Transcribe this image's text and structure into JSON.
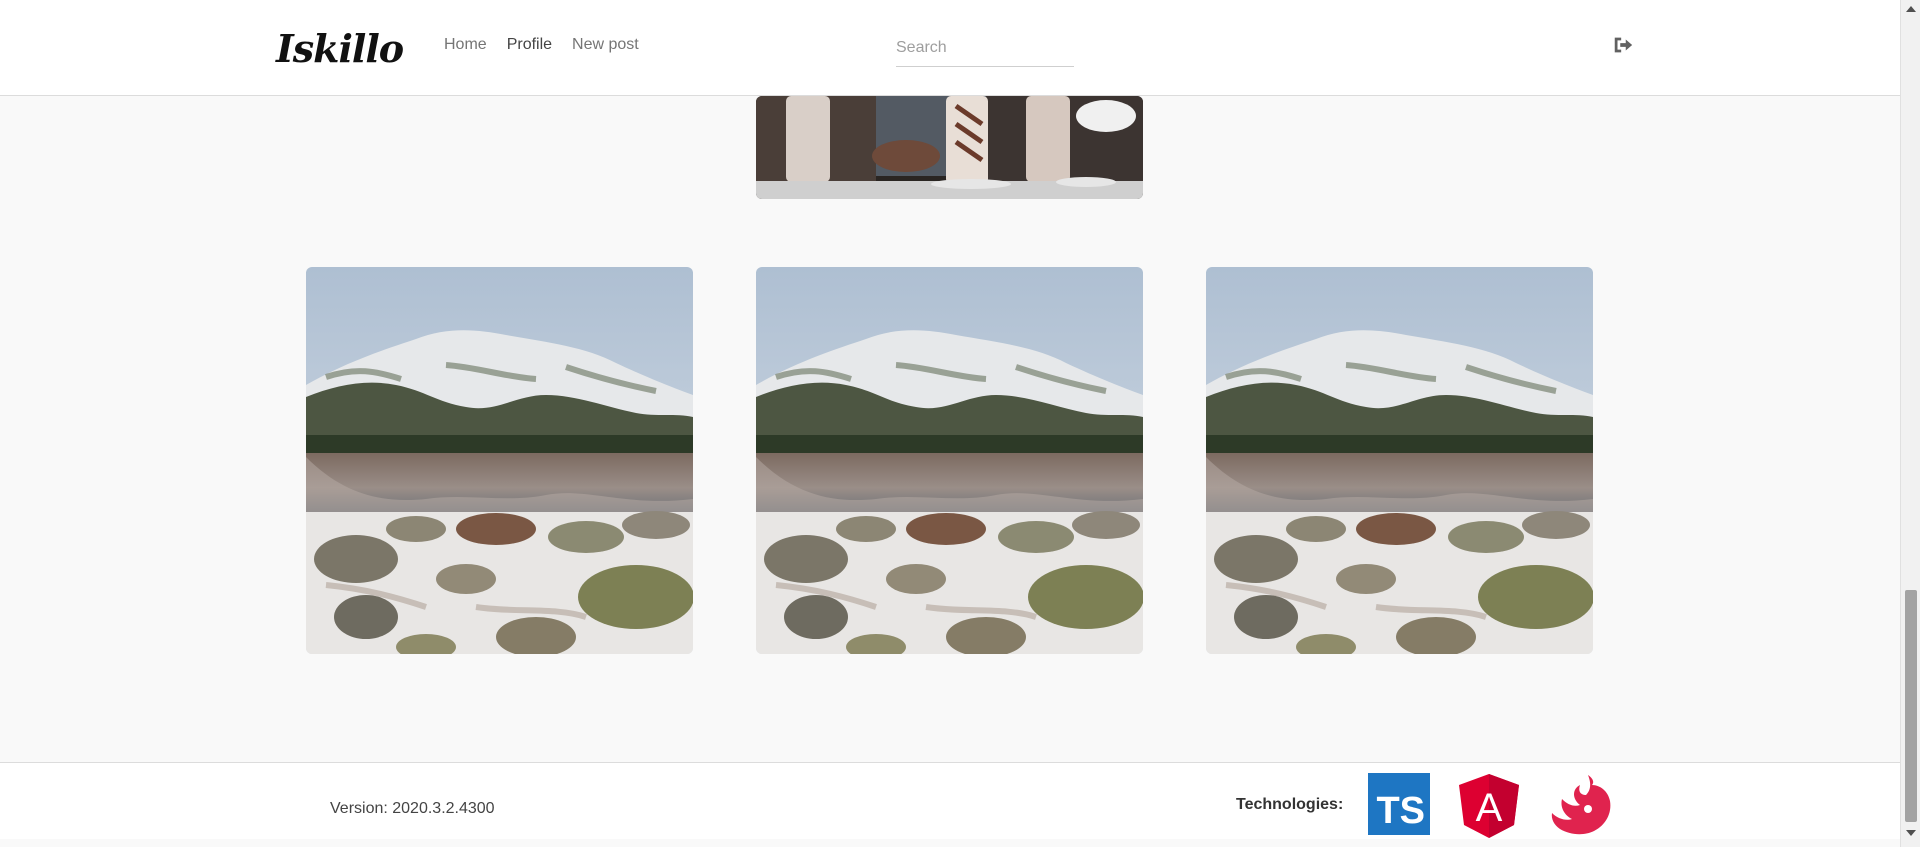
{
  "header": {
    "logo_text": "Iskillo",
    "nav": [
      {
        "label": "Home",
        "active": false
      },
      {
        "label": "Profile",
        "active": true
      },
      {
        "label": "New post",
        "active": false
      }
    ],
    "search_placeholder": "Search",
    "logout_icon": "sign-out-icon"
  },
  "gallery": {
    "posts": [
      {
        "image": "mountain-lake-snow"
      },
      {
        "image": "milkshakes-people"
      },
      {
        "image": "mountain-lake-snow"
      },
      {
        "image": "mountain-lake-snow"
      },
      {
        "image": "mountain-lake-snow"
      },
      {
        "image": "mountain-lake-snow"
      }
    ]
  },
  "footer": {
    "version": "Version: 2020.3.2.4300",
    "technologies_label": "Technologies:",
    "technologies": [
      {
        "name": "TypeScript",
        "badge": "TS",
        "color": "#1e76c3"
      },
      {
        "name": "Angular",
        "badge": "A",
        "color": "#dd0031"
      },
      {
        "name": "NestJS",
        "color": "#e0234e"
      }
    ]
  },
  "colors": {
    "page_bg": "#f9f9f9",
    "header_bg": "#ffffff",
    "accent": "#1e88c8"
  }
}
